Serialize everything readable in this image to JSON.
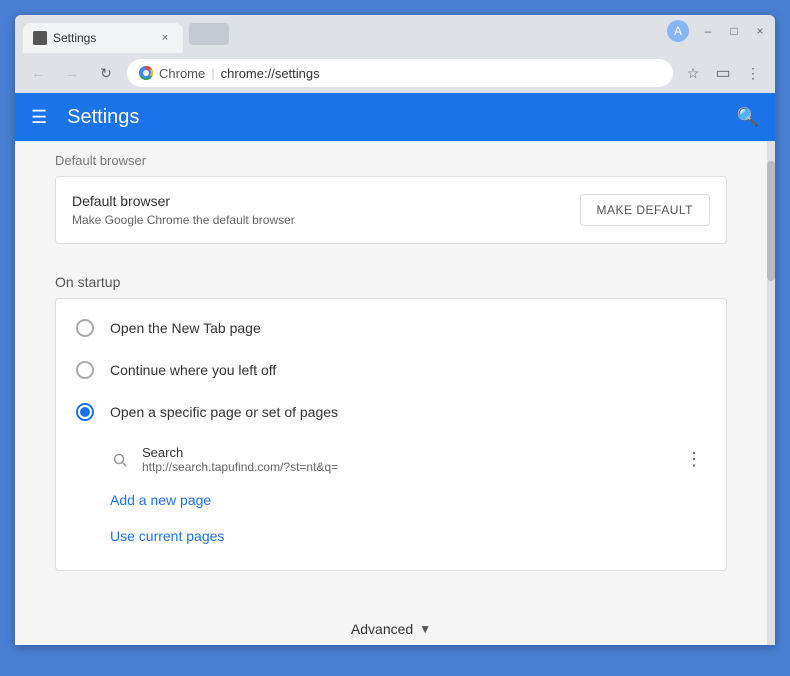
{
  "browser": {
    "tab_title": "Settings",
    "tab_close": "×",
    "url_prefix": "Chrome",
    "url": "chrome://settings",
    "profile_initial": "A"
  },
  "window_controls": {
    "minimize": "–",
    "maximize": "□",
    "close": "×"
  },
  "nav": {
    "back_disabled": true,
    "forward_disabled": true,
    "reload": "↻"
  },
  "address_bar": {
    "star_icon": "☆",
    "bookmark_icon": "⊡",
    "menu_icon": "⋮"
  },
  "header": {
    "title": "Settings",
    "menu_icon": "☰",
    "search_icon": "🔍"
  },
  "default_browser": {
    "section_label": "Default browser",
    "card_title": "Default browser",
    "card_subtitle": "Make Google Chrome the default browser",
    "button_label": "MAKE DEFAULT"
  },
  "on_startup": {
    "section_label": "On startup",
    "options": [
      {
        "id": "new-tab",
        "label": "Open the New Tab page",
        "selected": false
      },
      {
        "id": "continue",
        "label": "Continue where you left off",
        "selected": false
      },
      {
        "id": "specific",
        "label": "Open a specific page or set of pages",
        "selected": true
      }
    ],
    "pages": [
      {
        "title": "Search",
        "url": "http://search.tapufind.com/?st=nt&q="
      }
    ],
    "add_page_link": "Add a new page",
    "use_current_link": "Use current pages"
  },
  "advanced": {
    "label": "Advanced",
    "arrow": "▼"
  }
}
